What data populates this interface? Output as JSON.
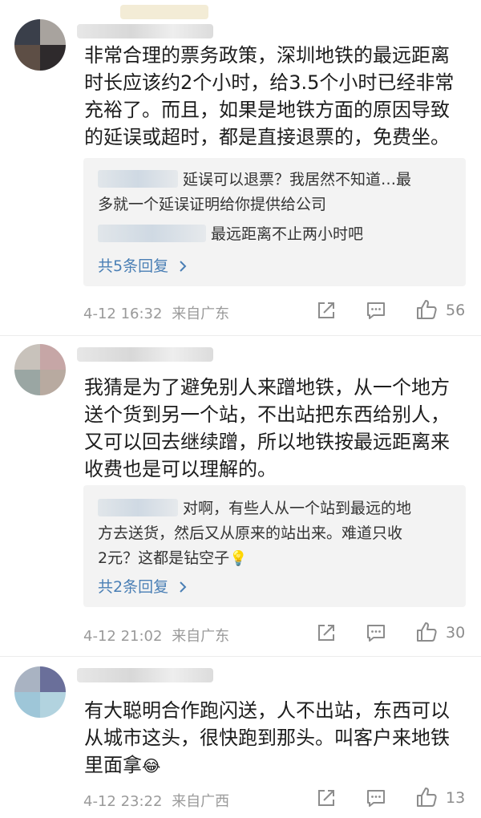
{
  "comments": [
    {
      "text_lines": [
        "非常合理的票务政策，深圳地铁的最远距离",
        "时长应该约2个小时，给3.5个小时已经非常",
        "充裕了。而且，如果是地铁方面的原因导致",
        "的延误或超时，都是直接退票的，免费坐。"
      ],
      "replies": [
        {
          "text_lines": [
            "延误可以退票？我居然不知道…最",
            "多就一个延误证明给你提供给公司"
          ]
        },
        {
          "text_lines": [
            "最远距离不止两小时吧"
          ]
        }
      ],
      "more_replies": "共5条回复",
      "time": "4-12 16:32",
      "source": "来自广东",
      "likes": "56"
    },
    {
      "text_lines": [
        "我猜是为了避免别人来蹭地铁，从一个地方",
        "送个货到另一个站，不出站把东西给别人，",
        "又可以回去继续蹭，所以地铁按最远距离来",
        "收费也是可以理解的。"
      ],
      "replies": [
        {
          "text_lines": [
            "对啊，有些人从一个站到最远的地",
            "方去送货，然后又从原来的站出来。难道只收",
            "2元？这都是钻空子"
          ]
        }
      ],
      "more_replies": "共2条回复",
      "time": "4-12 21:02",
      "source": "来自广东",
      "likes": "30"
    },
    {
      "text_lines": [
        "有大聪明合作跑闪送，人不出站，东西可以",
        "从城市这头，很快跑到那头。叫客户来地铁",
        "里面拿"
      ],
      "time": "4-12 23:22",
      "source": "来自广西",
      "likes": "13"
    }
  ],
  "icons": {
    "share": "share-icon",
    "comment": "comment-icon",
    "like": "thumbs-up-icon"
  },
  "colors": {
    "link": "#4a7fb5",
    "meta": "#9a9a9a",
    "reply_bg": "#f3f3f3"
  }
}
